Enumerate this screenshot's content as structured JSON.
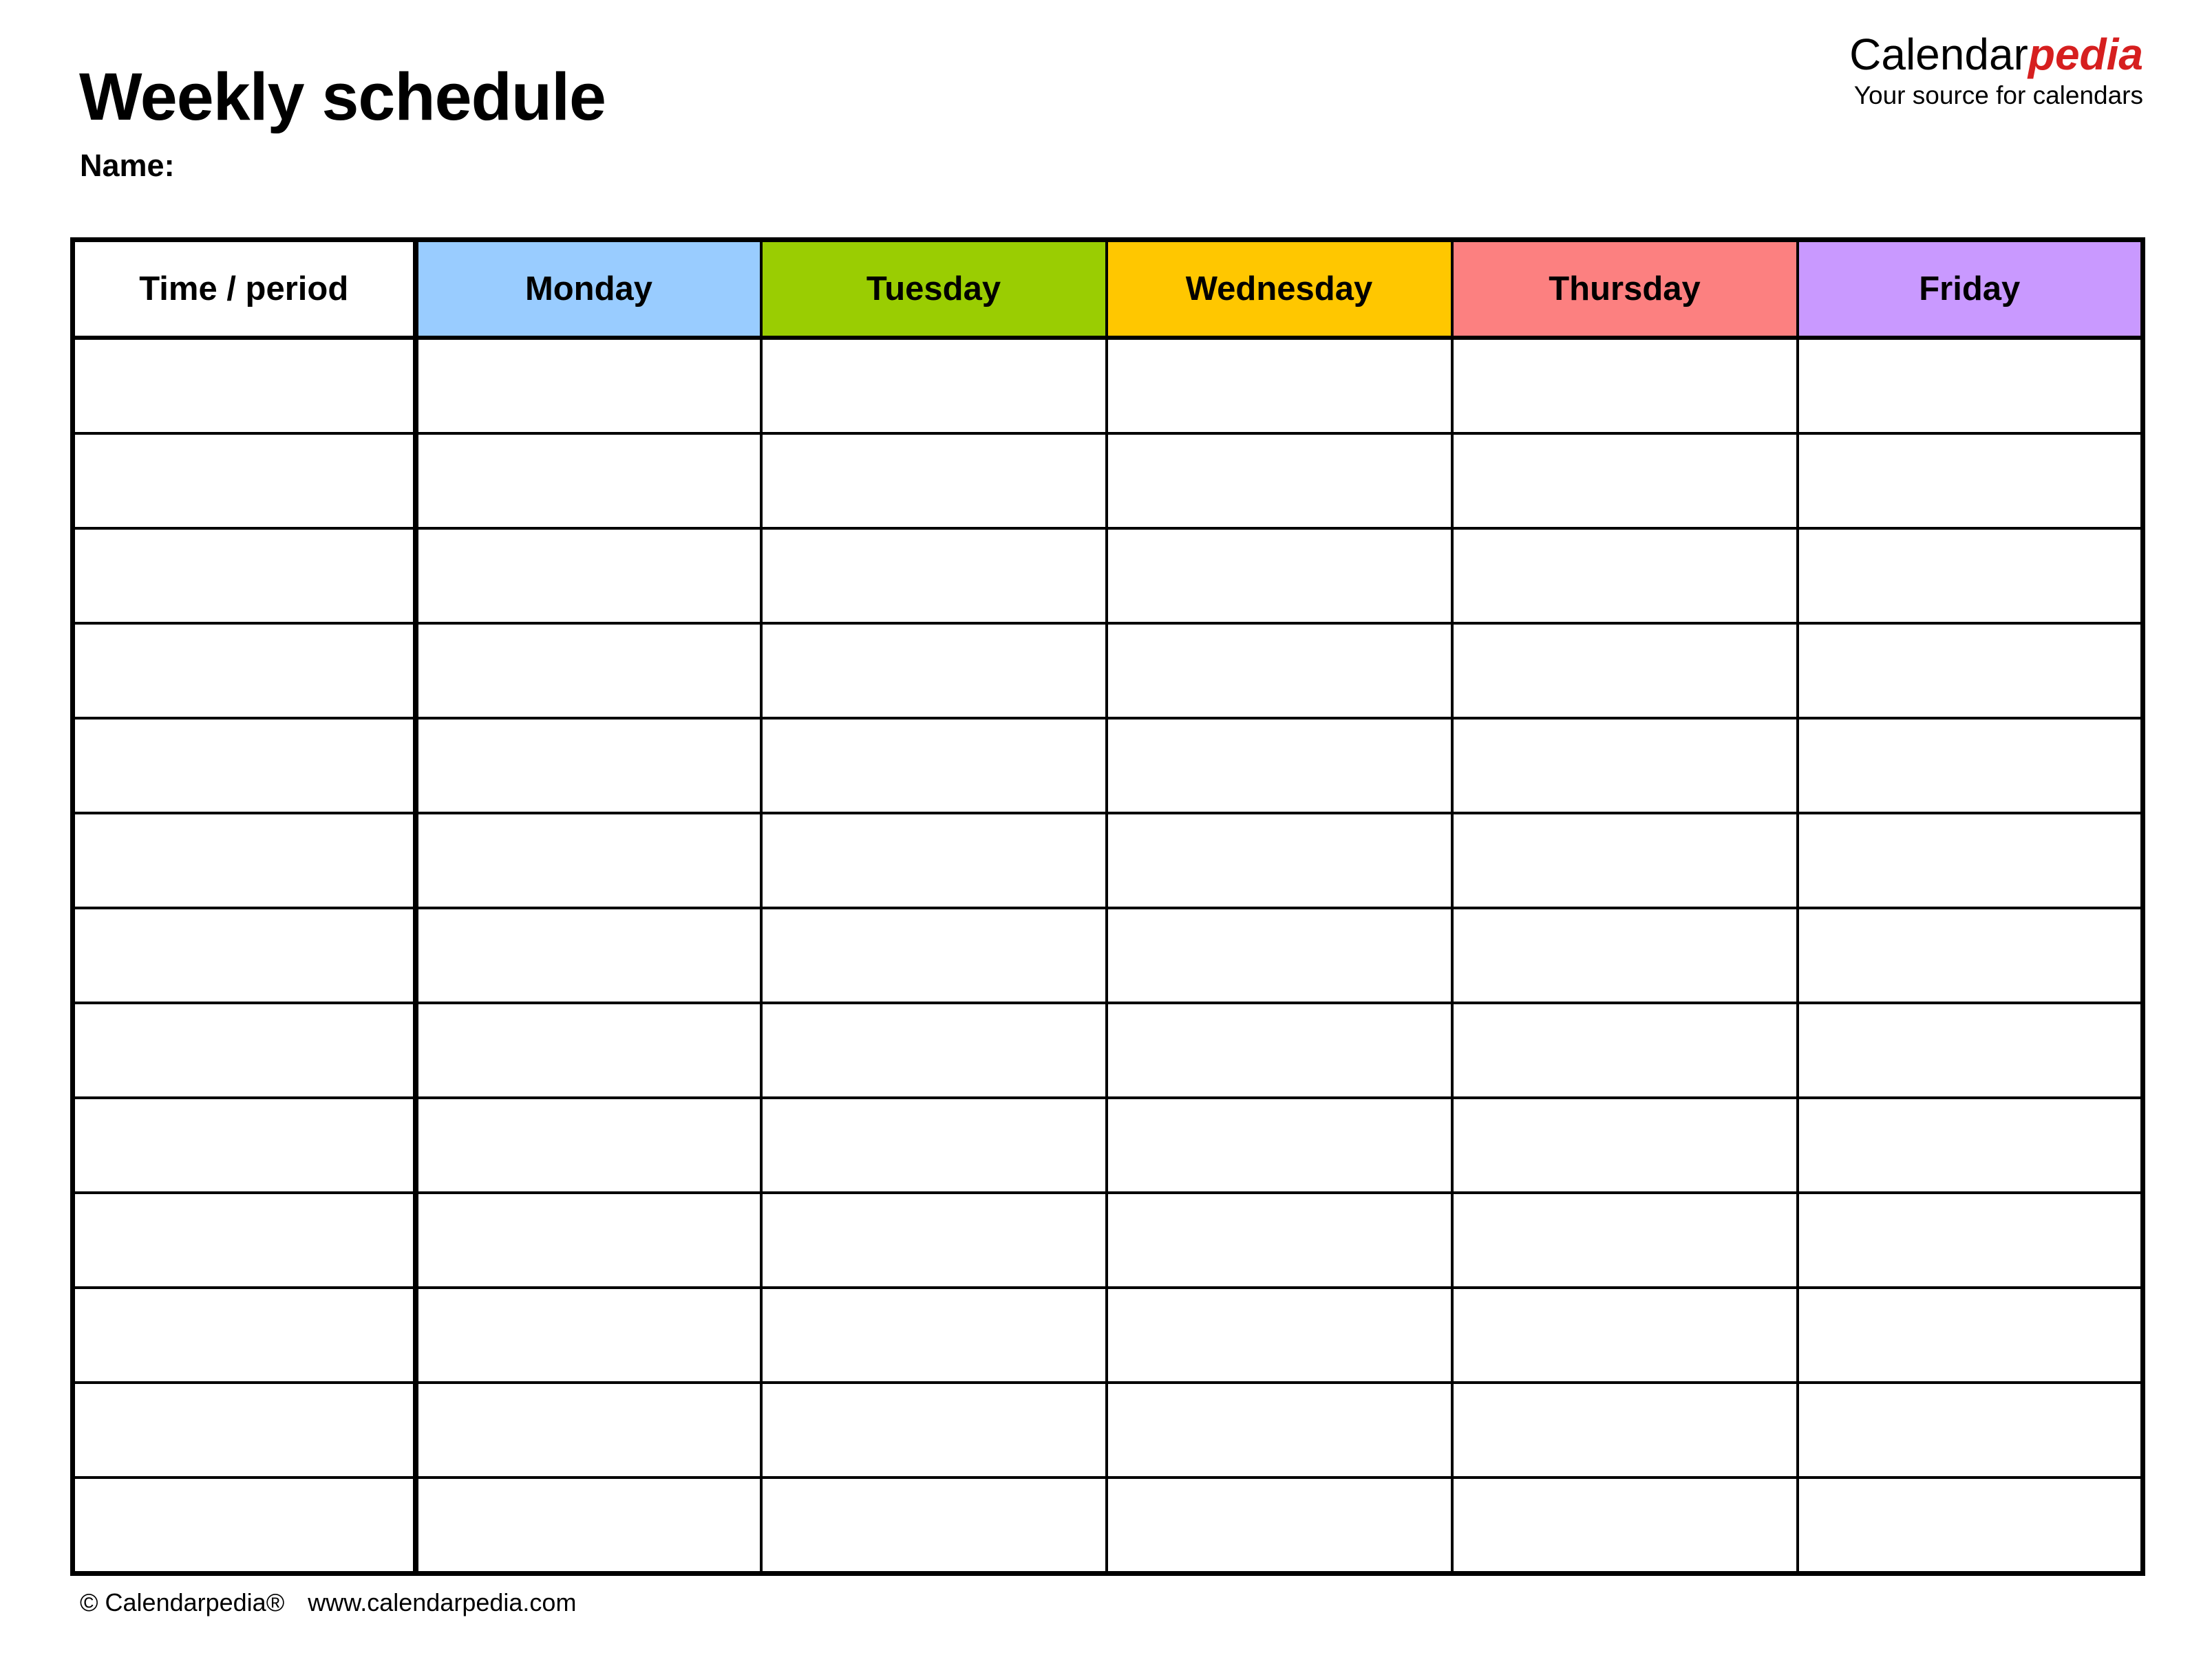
{
  "document": {
    "title": "Weekly schedule",
    "name_label": "Name:"
  },
  "brand": {
    "wordmark_primary": "Calendar",
    "wordmark_accent": "pedia",
    "tagline": "Your source for calendars",
    "accent_color": "#d61f1f",
    "primary_color": "#000000"
  },
  "table": {
    "columns": [
      {
        "key": "time",
        "label": "Time / period",
        "color": "#ffffff"
      },
      {
        "key": "monday",
        "label": "Monday",
        "color": "#99ccff"
      },
      {
        "key": "tuesday",
        "label": "Tuesday",
        "color": "#9acd02"
      },
      {
        "key": "wednesday",
        "label": "Wednesday",
        "color": "#ffc700"
      },
      {
        "key": "thursday",
        "label": "Thursday",
        "color": "#fc8080"
      },
      {
        "key": "friday",
        "label": "Friday",
        "color": "#c999ff"
      }
    ],
    "row_count": 13,
    "rows": [
      {
        "time": "",
        "monday": "",
        "tuesday": "",
        "wednesday": "",
        "thursday": "",
        "friday": ""
      },
      {
        "time": "",
        "monday": "",
        "tuesday": "",
        "wednesday": "",
        "thursday": "",
        "friday": ""
      },
      {
        "time": "",
        "monday": "",
        "tuesday": "",
        "wednesday": "",
        "thursday": "",
        "friday": ""
      },
      {
        "time": "",
        "monday": "",
        "tuesday": "",
        "wednesday": "",
        "thursday": "",
        "friday": ""
      },
      {
        "time": "",
        "monday": "",
        "tuesday": "",
        "wednesday": "",
        "thursday": "",
        "friday": ""
      },
      {
        "time": "",
        "monday": "",
        "tuesday": "",
        "wednesday": "",
        "thursday": "",
        "friday": ""
      },
      {
        "time": "",
        "monday": "",
        "tuesday": "",
        "wednesday": "",
        "thursday": "",
        "friday": ""
      },
      {
        "time": "",
        "monday": "",
        "tuesday": "",
        "wednesday": "",
        "thursday": "",
        "friday": ""
      },
      {
        "time": "",
        "monday": "",
        "tuesday": "",
        "wednesday": "",
        "thursday": "",
        "friday": ""
      },
      {
        "time": "",
        "monday": "",
        "tuesday": "",
        "wednesday": "",
        "thursday": "",
        "friday": ""
      },
      {
        "time": "",
        "monday": "",
        "tuesday": "",
        "wednesday": "",
        "thursday": "",
        "friday": ""
      },
      {
        "time": "",
        "monday": "",
        "tuesday": "",
        "wednesday": "",
        "thursday": "",
        "friday": ""
      },
      {
        "time": "",
        "monday": "",
        "tuesday": "",
        "wednesday": "",
        "thursday": "",
        "friday": ""
      }
    ]
  },
  "footer": {
    "copyright": "© Calendarpedia®",
    "website": "www.calendarpedia.com"
  }
}
